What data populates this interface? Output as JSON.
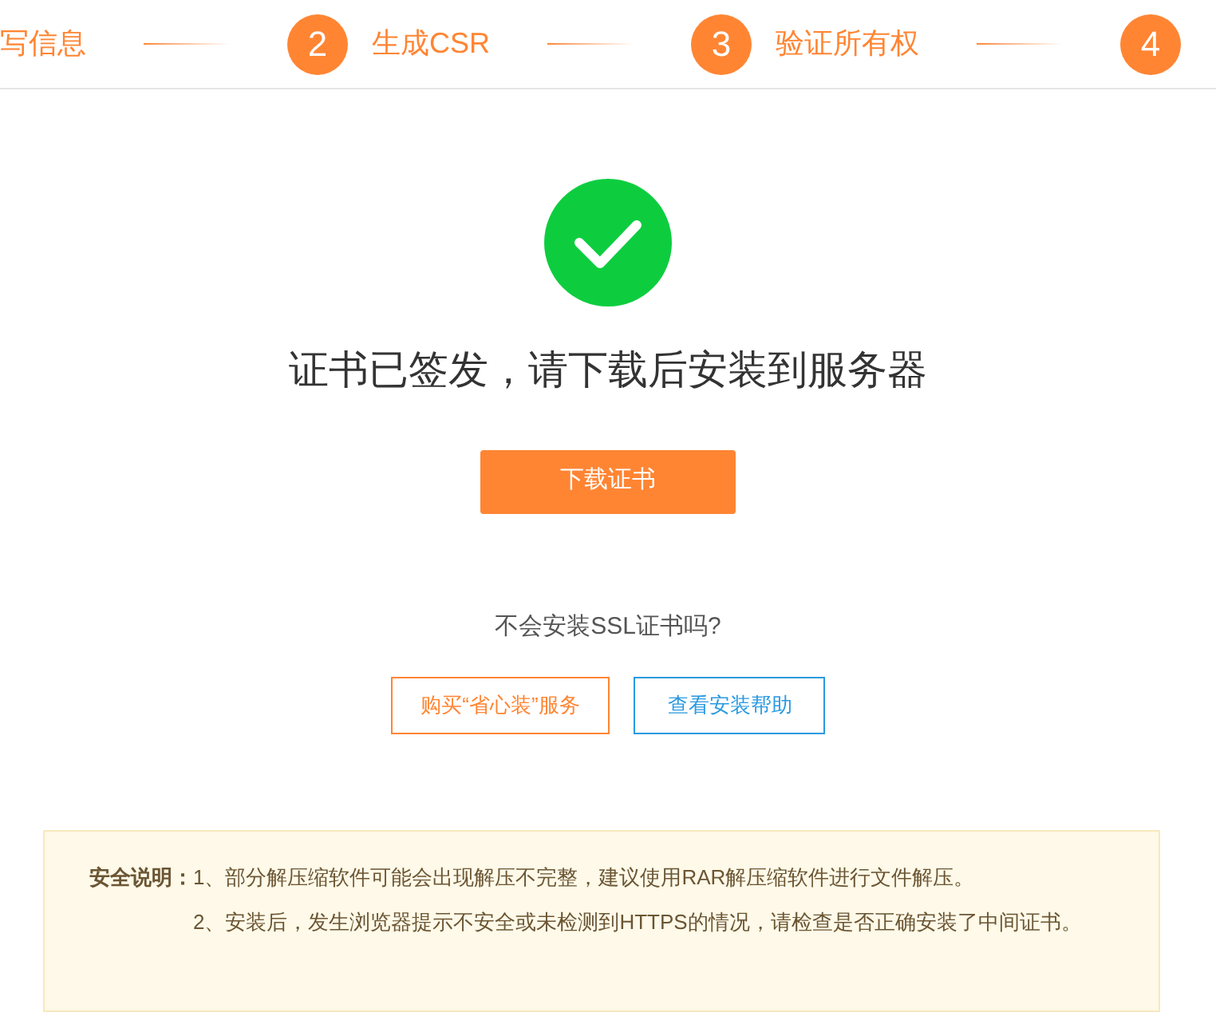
{
  "steps": [
    {
      "label": "写信息"
    },
    {
      "number": "2",
      "label": "生成CSR"
    },
    {
      "number": "3",
      "label": "验证所有权"
    },
    {
      "number": "4"
    }
  ],
  "result": {
    "title": "证书已签发，请下载后安装到服务器",
    "download_button": "下载证书"
  },
  "help": {
    "question": "不会安装SSL证书吗?",
    "buttons": [
      {
        "label": "购买“省心装”服务",
        "kind": "orange"
      },
      {
        "label": "查看安装帮助",
        "kind": "blue"
      }
    ]
  },
  "notice": {
    "heading": "安全说明：",
    "items": [
      "1、部分解压缩软件可能会出现解压不完整，建议使用RAR解压缩软件进行文件解压。",
      "2、安装后，发生浏览器提示不安全或未检测到HTTPS的情况，请检查是否正确安装了中间证书。"
    ]
  }
}
